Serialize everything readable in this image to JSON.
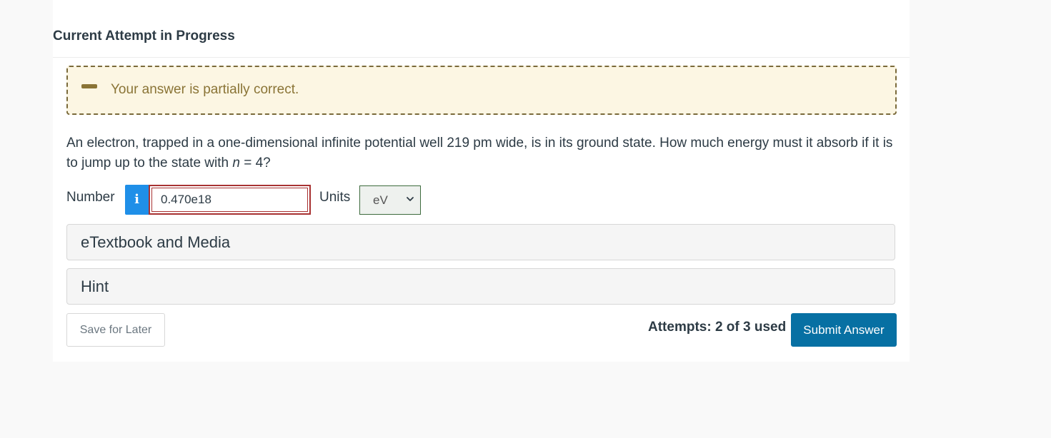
{
  "header": {
    "title": "Current Attempt in Progress"
  },
  "feedback": {
    "icon": "minus-icon",
    "message": "Your answer is partially correct.",
    "color": "#8a7436",
    "background": "#fcf6e3"
  },
  "question": {
    "text_before": "An electron, trapped in a one-dimensional infinite potential well 219 pm wide, is in its ground state. How much energy must it absorb if it is to jump up to the state with ",
    "variable": "n",
    "text_after": " = 4?"
  },
  "answer": {
    "number_label": "Number",
    "info_icon": "info-icon",
    "info_glyph": "i",
    "number_value": "0.470e18",
    "units_label": "Units",
    "units_selected": "eV"
  },
  "accordions": {
    "etextbook_label": "eTextbook and Media",
    "hint_label": "Hint"
  },
  "footer": {
    "save_label": "Save for Later",
    "attempts_text": "Attempts: 2 of 3 used",
    "submit_label": "Submit Answer"
  },
  "colors": {
    "accent": "#0770a3",
    "info": "#1f8fe8",
    "error_border": "#a83232"
  }
}
